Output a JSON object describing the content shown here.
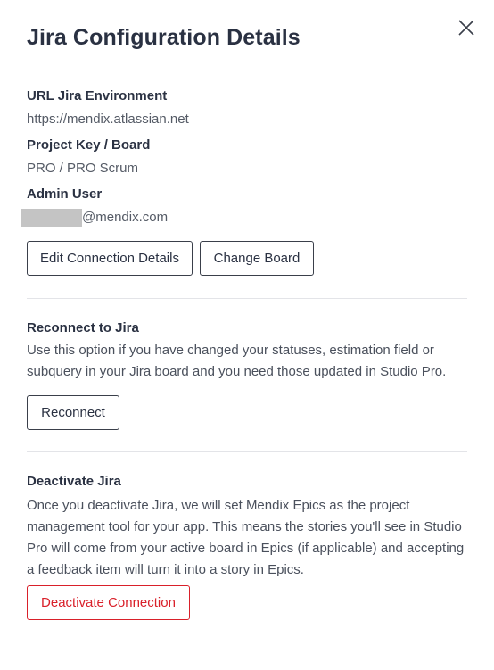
{
  "dialog": {
    "title": "Jira Configuration Details",
    "close_icon": "close-x-icon"
  },
  "details": {
    "url_label": "URL Jira Environment",
    "url_value": "https://mendix.atlassian.net",
    "project_label": "Project Key / Board",
    "project_value": "PRO / PRO Scrum",
    "admin_label": "Admin User",
    "admin_value": "@mendix.com",
    "edit_button": "Edit Connection Details",
    "change_board_button": "Change Board"
  },
  "reconnect": {
    "heading": "Reconnect to Jira",
    "description": "Use this option if you have changed your statuses, estimation field or subquery in your Jira board and you need those updated in Studio Pro.",
    "button": "Reconnect"
  },
  "deactivate": {
    "heading": "Deactivate Jira",
    "description": "Once you deactivate Jira, we will set Mendix Epics as the project management tool for your app. This means the stories you'll see in Studio Pro will come from your active board in Epics (if applicable) and accepting a feedback item will turn it into a story in Epics.",
    "button": "Deactivate Connection"
  },
  "colors": {
    "danger": "#d9202a",
    "heading": "#2a3142"
  }
}
